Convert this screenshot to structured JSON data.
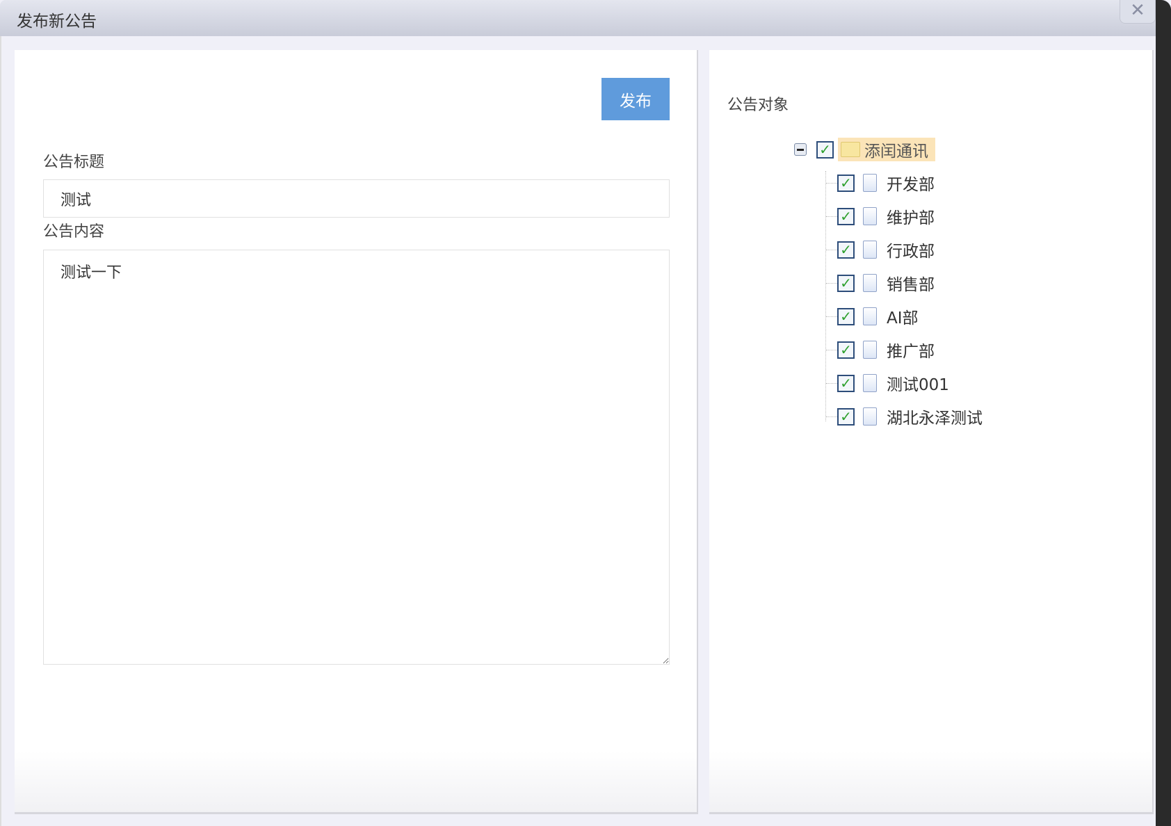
{
  "window": {
    "title": "发布新公告",
    "close_icon": "close-icon"
  },
  "form": {
    "publish_label": "发布",
    "title_label": "公告标题",
    "title_value": "测试",
    "content_label": "公告内容",
    "content_value": "测试一下"
  },
  "target": {
    "label": "公告对象",
    "root": "添闰通讯",
    "children": [
      "开发部",
      "维护部",
      "行政部",
      "销售部",
      "AI部",
      "推广部",
      "测试001",
      "湖北永泽测试"
    ]
  },
  "colors": {
    "accent": "#5f9bdc",
    "check": "#2ea02e"
  }
}
